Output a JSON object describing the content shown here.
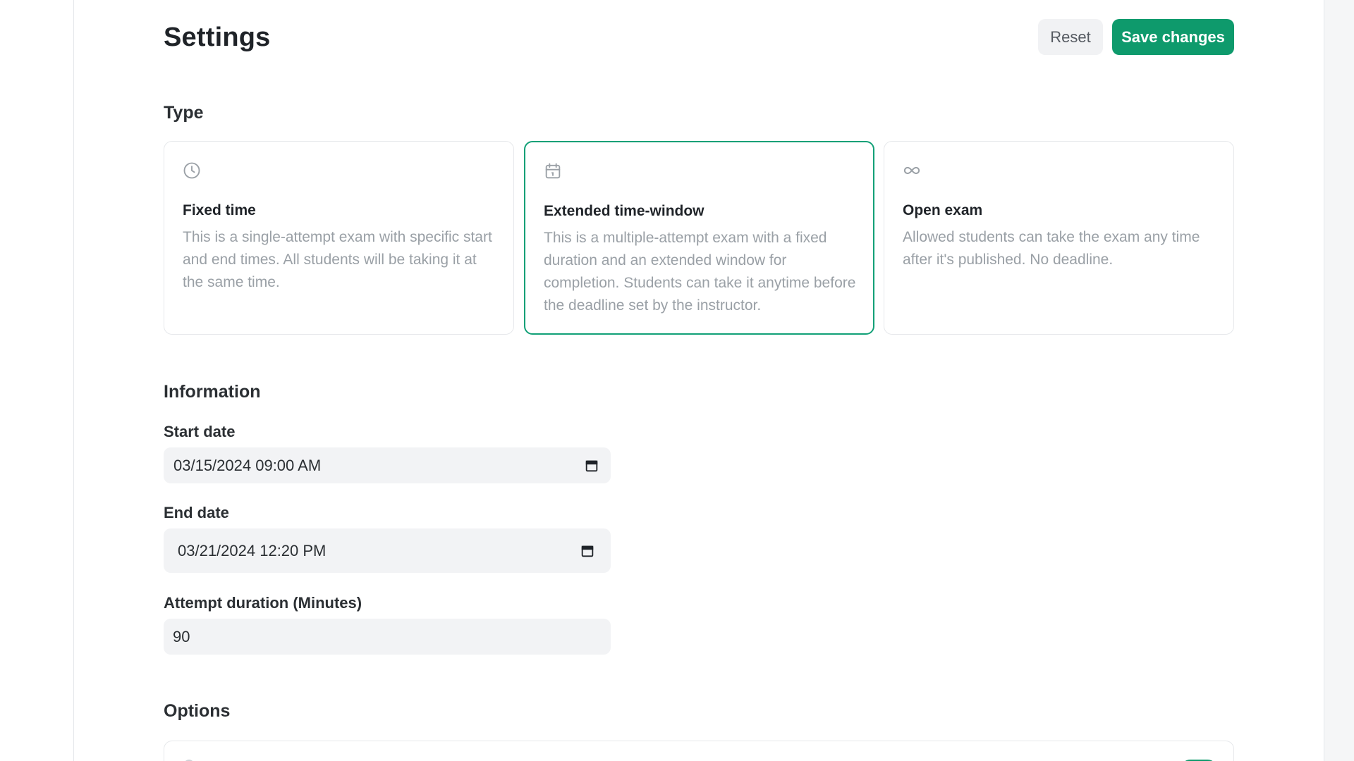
{
  "header": {
    "title": "Settings",
    "reset_label": "Reset",
    "save_label": "Save changes"
  },
  "type_section": {
    "title": "Type",
    "cards": [
      {
        "icon": "clock-icon",
        "title": "Fixed time",
        "description": "This is a single-attempt exam with specific start and end times. All students will be taking it at the same time.",
        "selected": false
      },
      {
        "icon": "calendar-icon",
        "title": "Extended time-window",
        "description": "This is a multiple-attempt exam with a fixed duration and an extended window for completion. Students can take it anytime before the deadline set by the instructor.",
        "selected": true
      },
      {
        "icon": "infinity-icon",
        "title": "Open exam",
        "description": "Allowed students can take the exam any time after it's published. No deadline.",
        "selected": false
      }
    ]
  },
  "information_section": {
    "title": "Information",
    "start_date": {
      "label": "Start date",
      "value": "03/15/2024 09:00 AM"
    },
    "end_date": {
      "label": "End date",
      "value": "03/21/2024 12:20 PM"
    },
    "attempt_duration": {
      "label": "Attempt duration (Minutes)",
      "value": "90"
    }
  },
  "options_section": {
    "title": "Options"
  },
  "colors": {
    "accent": "#0e9a6c",
    "selected_border": "#12a077",
    "input_bg": "#f2f3f5",
    "muted_text": "#9aa0a6"
  }
}
